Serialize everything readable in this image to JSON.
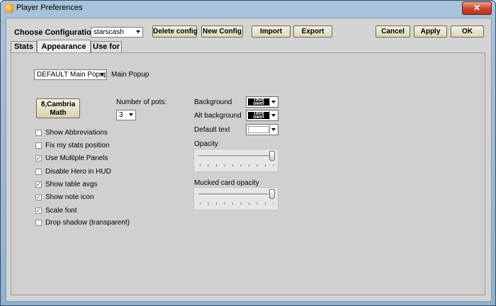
{
  "window": {
    "title": "Player Preferences",
    "close_label": "✕"
  },
  "toolbar": {
    "config_label": "Choose Configuration:",
    "config_value": "starscash",
    "delete_label": "Delete config",
    "new_label": "New Config",
    "import_label": "Import",
    "export_label": "Export",
    "cancel_label": "Cancel",
    "apply_label": "Apply",
    "ok_label": "OK"
  },
  "tabs": [
    {
      "label": "Stats",
      "active": false
    },
    {
      "label": "Appearance",
      "active": true
    },
    {
      "label": "Use for",
      "active": false
    }
  ],
  "appearance": {
    "popup_select_value": "DEFAULT Main Popup",
    "popup_label": "Main Popup",
    "font_button_label": "8,Cambria\nMath",
    "pots_label": "Number of pots:",
    "pots_value": "3",
    "checkboxes": [
      {
        "label": "Show Abbreviations",
        "checked": false
      },
      {
        "label": "Fix my stats position",
        "checked": false
      },
      {
        "label": "Use Multiple Panels",
        "checked": true
      },
      {
        "label": "Disable Hero in HUD",
        "checked": false
      },
      {
        "label": "Show table avgs",
        "checked": true
      },
      {
        "label": "Show note icon",
        "checked": true
      },
      {
        "label": "Scale font",
        "checked": true
      },
      {
        "label": "Drop shadow (transparent)",
        "checked": false
      }
    ],
    "background_label": "Background",
    "alt_background_label": "Alt background",
    "default_text_label": "Default text",
    "opacity_label": "Opacity",
    "opacity_value": 1.0,
    "mucked_label": "Mucked card opacity",
    "mucked_value": 1.0,
    "swatch_text": "Tave\nowel"
  },
  "colors": {
    "titlebar": "#a8c3dc",
    "client_bg": "#d4d4d4",
    "close_button": "#c9452c",
    "button_face": "#eeebd2"
  }
}
